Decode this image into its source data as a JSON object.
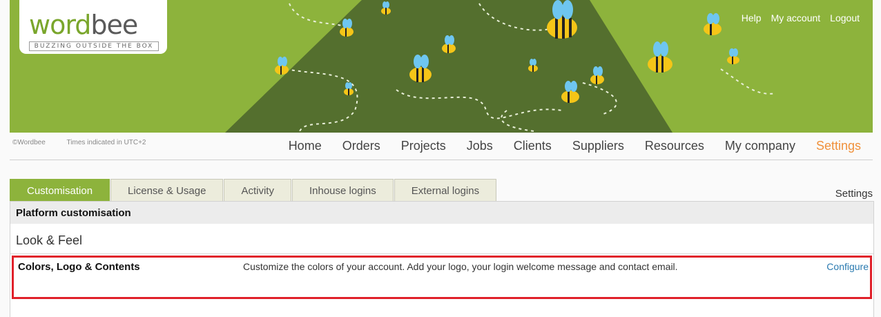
{
  "header": {
    "logo_word_a": "wo",
    "logo_word_b": "rd",
    "logo_word_c": "bee",
    "logo_tagline": "BUZZING OUTSIDE THE BOX",
    "links": [
      "Help",
      "My account",
      "Logout"
    ]
  },
  "meta": {
    "copyright": "©Wordbee",
    "timezone": "Times indicated in UTC+2"
  },
  "nav": {
    "items": [
      "Home",
      "Orders",
      "Projects",
      "Jobs",
      "Clients",
      "Suppliers",
      "Resources",
      "My company",
      "Settings"
    ],
    "active": "Settings"
  },
  "tabs": {
    "items": [
      "Customisation",
      "License & Usage",
      "Activity",
      "Inhouse logins",
      "External logins"
    ],
    "active": "Customisation",
    "right_label": "Settings"
  },
  "panel": {
    "title": "Platform customisation",
    "section": "Look & Feel",
    "rows": [
      {
        "name": "Colors, Logo & Contents",
        "description": "Customize the colors of your account. Add your logo, your login welcome message and contact email.",
        "action": "Configure"
      }
    ]
  },
  "colors": {
    "brand_green": "#8db33c",
    "dark_green": "#546f2e",
    "active_nav": "#f0903a",
    "link_blue": "#2a7ab0",
    "highlight_red": "#e0202a"
  }
}
